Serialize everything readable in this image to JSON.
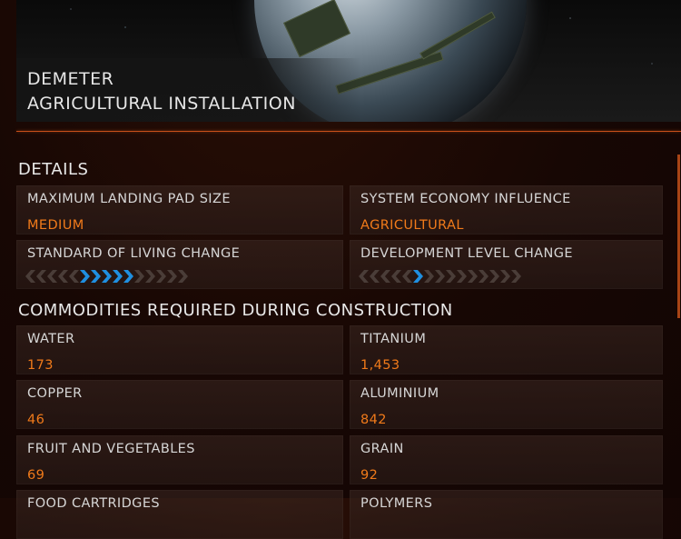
{
  "header": {
    "name": "DEMETER",
    "type": "AGRICULTURAL INSTALLATION"
  },
  "details": {
    "title": "DETAILS",
    "landing_pad": {
      "label": "MAXIMUM LANDING PAD SIZE",
      "value": "MEDIUM"
    },
    "economy": {
      "label": "SYSTEM ECONOMY INFLUENCE",
      "value": "AGRICULTURAL"
    },
    "standard_of_living": {
      "label": "STANDARD OF LIVING CHANGE",
      "chevrons": [
        "off-left",
        "off-left",
        "off-left",
        "off-left",
        "off-left",
        "on",
        "on",
        "on",
        "on",
        "on",
        "off",
        "off",
        "off",
        "off",
        "off"
      ]
    },
    "development": {
      "label": "DEVELOPMENT LEVEL CHANGE",
      "chevrons": [
        "off-left",
        "off-left",
        "off-left",
        "off-left",
        "off-left",
        "on",
        "off",
        "off",
        "off",
        "off",
        "off",
        "off",
        "off",
        "off",
        "off"
      ]
    }
  },
  "commodities": {
    "title": "COMMODITIES REQUIRED DURING CONSTRUCTION",
    "items": [
      {
        "label": "WATER",
        "value": "173"
      },
      {
        "label": "TITANIUM",
        "value": "1,453"
      },
      {
        "label": "COPPER",
        "value": "46"
      },
      {
        "label": "ALUMINIUM",
        "value": "842"
      },
      {
        "label": "FRUIT AND VEGETABLES",
        "value": "69"
      },
      {
        "label": "GRAIN",
        "value": "92"
      },
      {
        "label": "FOOD CARTRIDGES",
        "value": ""
      },
      {
        "label": "POLYMERS",
        "value": ""
      }
    ]
  },
  "colors": {
    "accent": "#f07a1a",
    "rule": "#c9501a",
    "chevron_on": "#1f8fe0"
  }
}
